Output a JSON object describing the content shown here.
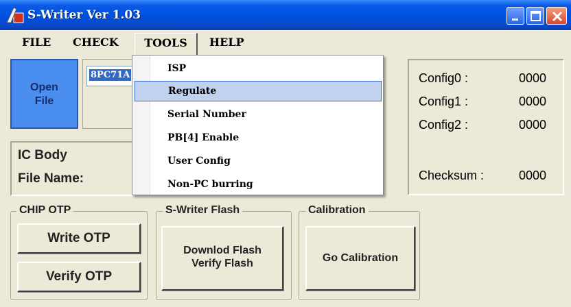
{
  "window": {
    "title": "S-Writer Ver 1.03",
    "accent": "#0050E0"
  },
  "menubar": {
    "items": [
      "FILE",
      "CHECK",
      "TOOLS",
      "HELP"
    ],
    "active": "TOOLS"
  },
  "tools_menu": {
    "items": [
      "ISP",
      "Regulate",
      "Serial Number",
      "PB[4] Enable",
      "User Config",
      "Non-PC burring"
    ],
    "highlighted": "Regulate"
  },
  "open_file": {
    "line1": "Open",
    "line2": "File"
  },
  "chip_select": {
    "value": "8PC71A"
  },
  "config": {
    "config0_label": "Config0 :",
    "config0_value": "0000",
    "config1_label": "Config1 :",
    "config1_value": "0000",
    "config2_label": "Config2 :",
    "config2_value": "0000",
    "checksum_label": "Checksum :",
    "checksum_value": "0000"
  },
  "ic_body": {
    "line1": "IC Body",
    "line2": "File Name:"
  },
  "chip_otp": {
    "title": "CHIP OTP",
    "write_label": "Write OTP",
    "verify_label": "Verify OTP"
  },
  "swriter_flash": {
    "title": "S-Writer Flash",
    "button_line1": "Downlod Flash",
    "button_line2": "Verify Flash"
  },
  "calibration": {
    "title": "Calibration",
    "button_label": "Go Calibration"
  }
}
